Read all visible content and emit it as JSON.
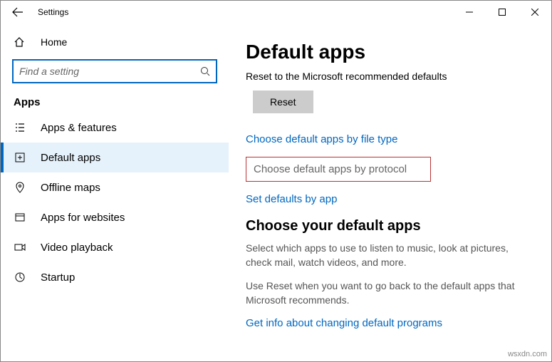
{
  "window": {
    "title": "Settings"
  },
  "sidebar": {
    "home": "Home",
    "search_placeholder": "Find a setting",
    "section": "Apps",
    "items": [
      {
        "label": "Apps & features"
      },
      {
        "label": "Default apps"
      },
      {
        "label": "Offline maps"
      },
      {
        "label": "Apps for websites"
      },
      {
        "label": "Video playback"
      },
      {
        "label": "Startup"
      }
    ]
  },
  "main": {
    "title": "Default apps",
    "reset_text": "Reset to the Microsoft recommended defaults",
    "reset_button": "Reset",
    "link_filetype": "Choose default apps by file type",
    "link_protocol": "Choose default apps by protocol",
    "link_byapp": "Set defaults by app",
    "choose_title": "Choose your default apps",
    "choose_desc": "Select which apps to use to listen to music, look at pictures, check mail, watch videos, and more.",
    "reset_desc": "Use Reset when you want to go back to the default apps that Microsoft recommends.",
    "link_info": "Get info about changing default programs"
  },
  "watermark": "wsxdn.com"
}
